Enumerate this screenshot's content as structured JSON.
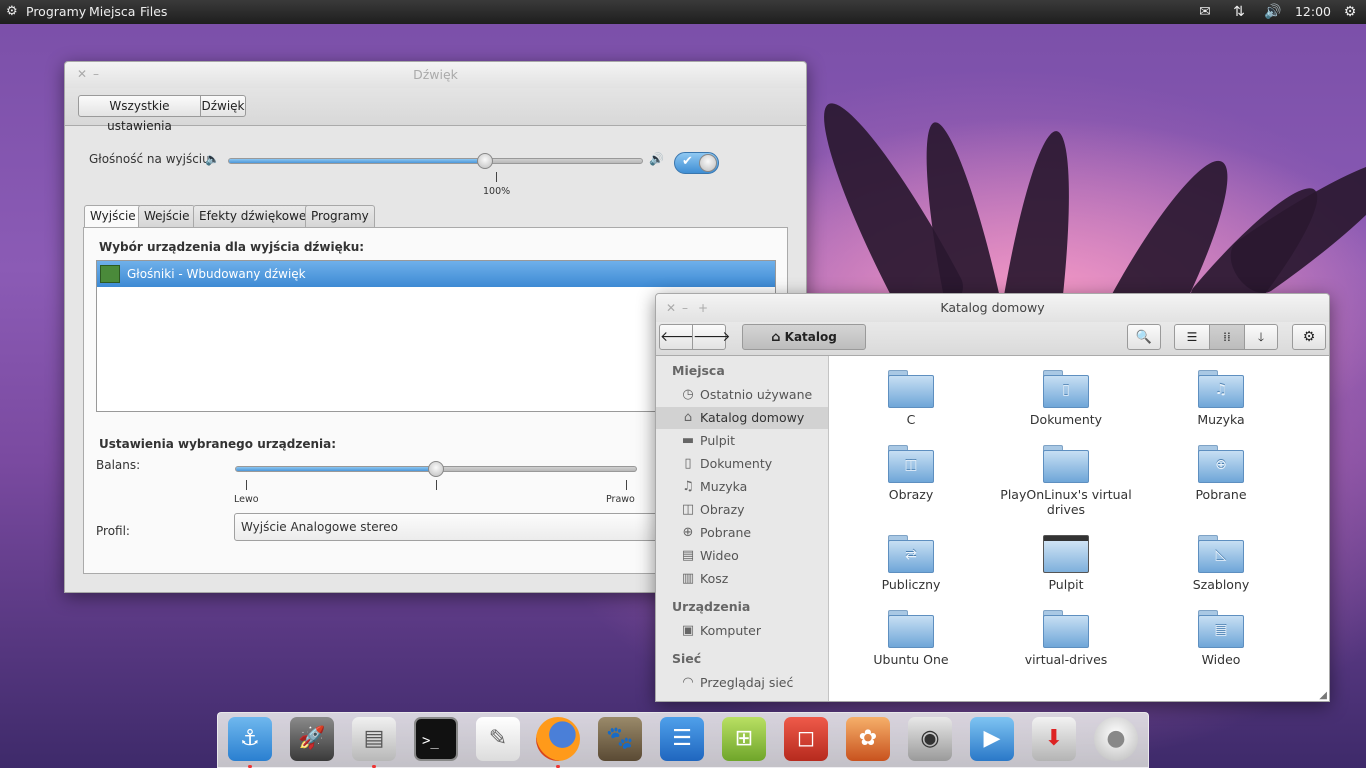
{
  "top_panel": {
    "menu": [
      "Programy",
      "Miejsca",
      "Files"
    ],
    "clock": "12:00",
    "icons": [
      "apps-icon",
      "mail-icon",
      "network-icon",
      "volume-icon",
      "settings-icon"
    ]
  },
  "sound_window": {
    "title": "Dźwięk",
    "breadcrumb": [
      "Wszystkie ustawienia",
      "Dźwięk"
    ],
    "output_volume_label": "Głośność na wyjściu:",
    "output_volume_percent": 0.62,
    "mark_100": "100%",
    "switch_on": true,
    "tabs": [
      "Wyjście",
      "Wejście",
      "Efekty dźwiękowe",
      "Programy"
    ],
    "active_tab": "Wyjście",
    "device_heading": "Wybór urządzenia dla wyjścia dźwięku:",
    "devices": [
      "Głośniki - Wbudowany dźwięk"
    ],
    "settings_heading": "Ustawienia wybranego urządzenia:",
    "balance_label": "Balans:",
    "balance_value": 0.5,
    "balance_left": "Lewo",
    "balance_right": "Prawo",
    "profile_label": "Profil:",
    "profile_value": "Wyjście Analogowe stereo"
  },
  "file_manager": {
    "title": "Katalog domowy",
    "path_button": "Katalog domowy",
    "sidebar": {
      "places_heading": "Miejsca",
      "places": [
        {
          "label": "Ostatnio używane",
          "icon": "clock-icon"
        },
        {
          "label": "Katalog domowy",
          "icon": "home-icon",
          "selected": true
        },
        {
          "label": "Pulpit",
          "icon": "folder-icon"
        },
        {
          "label": "Dokumenty",
          "icon": "document-icon"
        },
        {
          "label": "Muzyka",
          "icon": "music-icon"
        },
        {
          "label": "Obrazy",
          "icon": "image-icon"
        },
        {
          "label": "Pobrane",
          "icon": "download-icon"
        },
        {
          "label": "Wideo",
          "icon": "video-icon"
        },
        {
          "label": "Kosz",
          "icon": "trash-icon"
        }
      ],
      "devices_heading": "Urządzenia",
      "devices": [
        {
          "label": "Komputer",
          "icon": "computer-icon"
        }
      ],
      "network_heading": "Sieć",
      "network": [
        {
          "label": "Przeglądaj sieć",
          "icon": "wifi-icon"
        }
      ]
    },
    "folders": [
      "C",
      "Dokumenty",
      "Muzyka",
      "Obrazy",
      "PlayOnLinux's virtual drives",
      "Pobrane",
      "Publiczny",
      "Pulpit",
      "Szablony",
      "Ubuntu One",
      "virtual-drives",
      "Wideo"
    ]
  },
  "dock": {
    "apps": [
      "anchor-icon",
      "rocket-icon",
      "file-cabinet-icon",
      "terminal-icon",
      "text-editor-icon",
      "firefox-icon",
      "gimp-icon",
      "writer-icon",
      "calc-icon",
      "impress-icon",
      "photo-icon",
      "speaker-icon",
      "media-player-icon",
      "installer-icon",
      "disk-icon"
    ]
  }
}
